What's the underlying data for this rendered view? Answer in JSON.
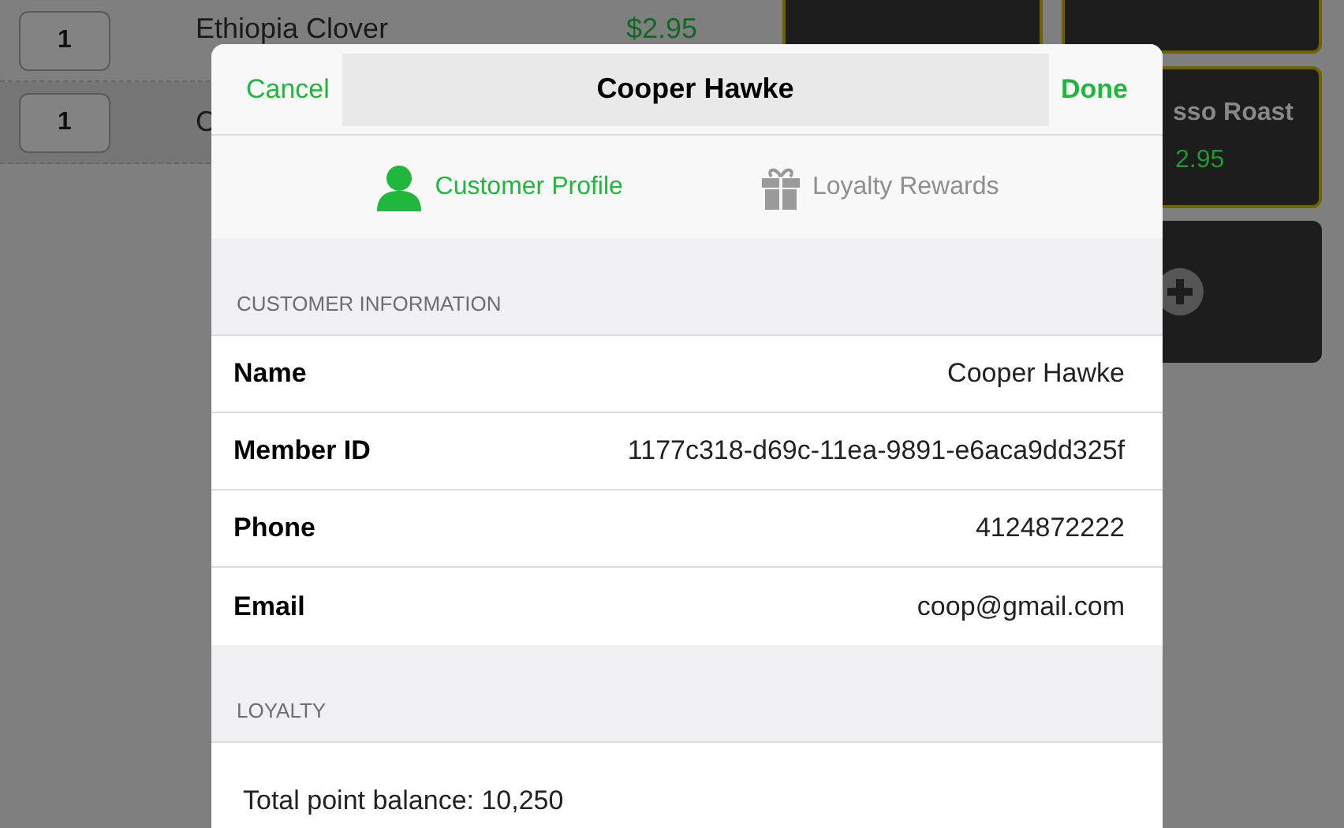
{
  "order_items": [
    {
      "qty": "1",
      "name": "Ethiopia Clover",
      "price": "$2.95"
    },
    {
      "qty": "1",
      "name": "C"
    }
  ],
  "tiles": [
    {
      "kind": "product",
      "name": "sso Roast",
      "price": "2.95"
    },
    {
      "kind": "add"
    }
  ],
  "modal": {
    "cancel": "Cancel",
    "title": "Cooper Hawke",
    "done": "Done",
    "tabs": [
      {
        "label": "Customer Profile",
        "selected": true
      },
      {
        "label": "Loyalty Rewards",
        "selected": false
      }
    ],
    "sections": [
      {
        "header": "CUSTOMER INFORMATION",
        "rows": [
          {
            "label": "Name",
            "value": "Cooper Hawke"
          },
          {
            "label": "Member ID",
            "value": "1177c318-d69c-11ea-9891-e6aca9dd325f"
          },
          {
            "label": "Phone",
            "value": "4124872222"
          },
          {
            "label": "Email",
            "value": "coop@gmail.com"
          }
        ]
      },
      {
        "header": "LOYALTY",
        "rows": [
          {
            "text": "Total point balance: 10,250"
          }
        ]
      }
    ]
  }
}
